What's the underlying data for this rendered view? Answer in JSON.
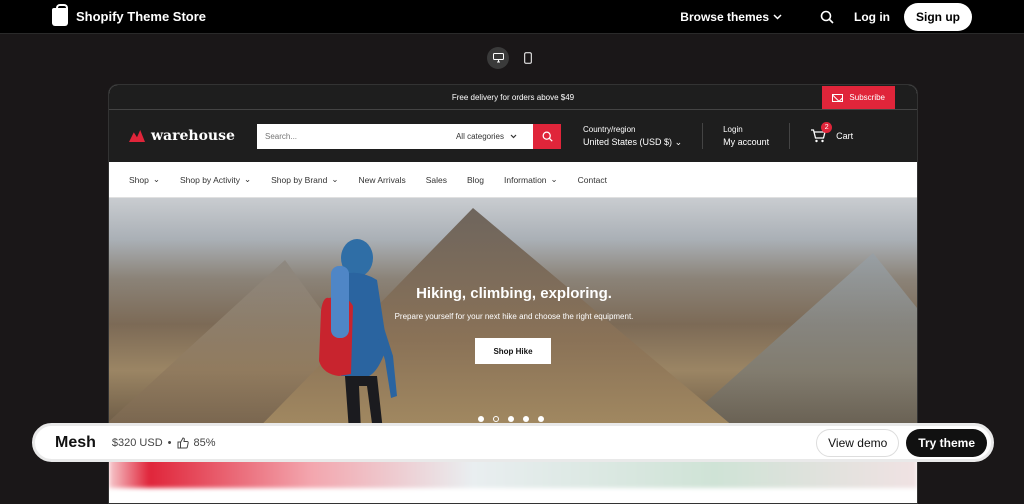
{
  "topbar": {
    "brand": "Shopify Theme Store",
    "browse": "Browse themes",
    "login": "Log in",
    "signup": "Sign up"
  },
  "preview": {
    "announcement": "Free delivery for orders above $49",
    "subscribe": "Subscribe",
    "logo": "warehouse",
    "search_placeholder": "Search...",
    "category": "All categories",
    "region_label": "Country/region",
    "region_value": "United States (USD $)",
    "login_label": "Login",
    "account": "My account",
    "cart": "Cart",
    "cart_count": "2",
    "nav": [
      {
        "label": "Shop"
      },
      {
        "label": "Shop by Activity"
      },
      {
        "label": "Shop by Brand"
      },
      {
        "label": "New Arrivals"
      },
      {
        "label": "Sales"
      },
      {
        "label": "Blog"
      },
      {
        "label": "Information"
      },
      {
        "label": "Contact"
      }
    ],
    "hero": {
      "title": "Hiking, climbing, exploring.",
      "subtitle": "Prepare yourself for your next hike and choose the right equipment.",
      "button": "Shop Hike",
      "slide_count": 5,
      "active_slide": 2
    }
  },
  "bottombar": {
    "theme_name": "Mesh",
    "price": "$320 USD",
    "separator": "•",
    "rating": "85%",
    "view_demo": "View demo",
    "try_theme": "Try theme"
  },
  "colors": {
    "accent": "#e0253a",
    "dark": "#1e1e1e"
  }
}
